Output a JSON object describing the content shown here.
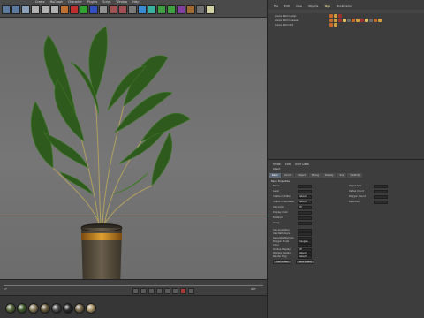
{
  "top_menu": {
    "items": [
      "Create",
      "MoGraph",
      "Character",
      "Plugins",
      "Script",
      "Window",
      "Help"
    ]
  },
  "toolbar": {
    "icons": [
      "undo-icon",
      "redo-icon",
      "live-select-icon",
      "move-icon",
      "scale-icon",
      "rotate-icon",
      "object-icon",
      "x-axis-icon",
      "y-axis-icon",
      "z-axis-icon",
      "coordinate-icon",
      "render-view-icon",
      "render-pic-icon",
      "render-settings-icon",
      "cube-icon",
      "spline-icon",
      "nurbs-icon",
      "array-icon",
      "deformer-icon",
      "scene-icon",
      "camera-icon",
      "light-icon"
    ]
  },
  "object_manager": {
    "menu": [
      "File",
      "Edit",
      "View",
      "Objects",
      "Tags",
      "Bookmarks"
    ],
    "active_menu": "Tags",
    "rows": [
      {
        "name": "Areca Palm Lamp",
        "tags": 3
      },
      {
        "name": "Areca Palm Leaves",
        "tags": 12
      },
      {
        "name": "Areca Palm Pot",
        "tags": 2
      }
    ]
  },
  "attribute_manager": {
    "menu": [
      "Mode",
      "Edit",
      "User Data"
    ],
    "object_label": "Object",
    "tabs": [
      "Basic",
      "Coord.",
      "Object",
      "Phong",
      "Display",
      "Sub",
      "Visibility"
    ],
    "active_tab": "Basic",
    "section_title": "Basic Properties",
    "rows_left": [
      {
        "label": "Name",
        "value": ""
      },
      {
        "label": "Layer",
        "value": ""
      },
      {
        "label": "Visible in Editor",
        "value": "Default"
      },
      {
        "label": "Visible in Renderer",
        "value": "Default"
      },
      {
        "label": "Use Color",
        "value": "Off"
      },
      {
        "label": "Display Color",
        "value": ""
      },
      {
        "label": "Enabled",
        "value": ""
      },
      {
        "label": "X-Ray",
        "value": ""
      }
    ],
    "rows_right": [
      {
        "label": "Object Size",
        "value": ""
      },
      {
        "label": "Vertex Count",
        "value": ""
      },
      {
        "label": "Polygon Count",
        "value": ""
      },
      {
        "label": "Selection",
        "value": ""
      }
    ],
    "lower_rows": [
      {
        "label": "Use Animation",
        "value": ""
      },
      {
        "label": "Use Deformers",
        "value": ""
      },
      {
        "label": "Generate Normals",
        "value": ""
      },
      {
        "label": "Polygon Mode",
        "value": "Triangles"
      },
      {
        "label": "Color",
        "value": ""
      },
      {
        "label": "Outline Display",
        "value": "Off"
      },
      {
        "label": "Shadow Casting",
        "value": "Default"
      },
      {
        "label": "Render Flag",
        "value": "Default"
      }
    ],
    "buttons": [
      "Load Preset",
      "Save Preset"
    ]
  },
  "timeline": {
    "frame_label": "0 F",
    "end_label": "90 F"
  },
  "materials": {
    "swatches": [
      "#5a6a3a",
      "#3f5a2a",
      "#8a7a5a",
      "#6a5a3a",
      "#4a4a4a",
      "#2a2a2a",
      "#7a6a4a",
      "#b09a6a"
    ]
  }
}
